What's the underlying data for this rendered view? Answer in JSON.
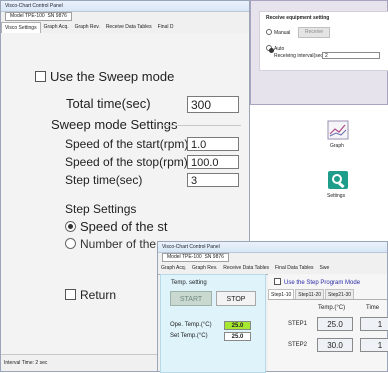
{
  "main_window": {
    "title": "Visco-Chart Control Panel",
    "model_label": "Model",
    "model_value": "TPE-100",
    "sn_label": "SN",
    "sn_value": "9876",
    "tabs": [
      "Visco Settings",
      "Graph Acq.",
      "Graph Rev.",
      "Receive Data Tables",
      "Final D"
    ],
    "use_sweep_label": "Use the Sweep mode",
    "total_time_label": "Total time(sec)",
    "total_time_value": "300",
    "sweep_settings_label": "Sweep mode Settings",
    "start_speed_label": "Speed of the start(rpm)",
    "start_speed_value": "1.0",
    "stop_speed_label": "Speed of the stop(rpm)",
    "stop_speed_value": "100.0",
    "step_time_label": "Step time(sec)",
    "step_time_value": "3",
    "step_settings_label": "Step Settings",
    "speed_radio_label": "Speed of the st",
    "number_radio_label": "Number of the s",
    "return_label": "Return",
    "status_text": "Interval Time: 2 sec"
  },
  "receive_window": {
    "group_title": "Receive equipment setting",
    "manual_label": "Manual",
    "receive_button": "Receive",
    "auto_label": "Auto",
    "interval_label": "Receiving interval(sec)",
    "interval_value": "2"
  },
  "toolbar": {
    "graph_label": "Graph",
    "settings_label": "Settings"
  },
  "step_window": {
    "title": "Visco-Chart Control Panel",
    "model_label": "Model",
    "model_value": "TPE-100",
    "sn_label": "SN",
    "sn_value": "9876",
    "tabs": [
      "Graph Acq.",
      "Graph Rev.",
      "Receive Data Tables",
      "Final Data Tables",
      "Swe"
    ],
    "temp_setting_label": "Temp. setting",
    "start_button": "START",
    "stop_button": "STOP",
    "ope_temp_label": "Ope. Temp.(°C)",
    "ope_temp_value": "25.0",
    "set_temp_label": "Set Temp.(°C)",
    "set_temp_value": "25.0",
    "use_step_program_label": "Use the Step Program Mode",
    "step_tabs": [
      "Step1-10",
      "Step11-20",
      "Step21-30"
    ],
    "col_temp": "Temp.(°C)",
    "col_time": "Time",
    "rows": [
      {
        "label": "STEP1",
        "temp": "25.0",
        "time": "1"
      },
      {
        "label": "STEP2",
        "temp": "30.0",
        "time": "1"
      }
    ]
  },
  "colors": {
    "ope_temp_bg": "#a6e830",
    "side_panel_bg": "#dff3fb",
    "receive_window_bg": "#e6e3ec",
    "use_step_label_color": "#2a2aa8"
  }
}
